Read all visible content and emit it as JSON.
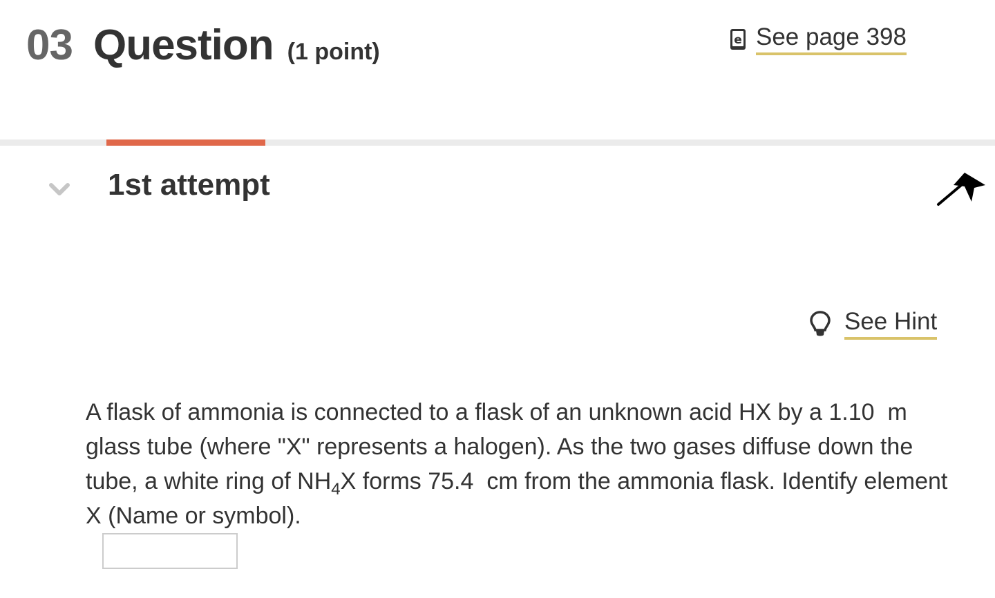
{
  "question": {
    "number": "03",
    "title": "Question",
    "points": "(1 point)",
    "reference_link": "See page 398",
    "reference_icon": "ebook-icon"
  },
  "progress": {
    "fill_fraction": 0.16,
    "color": "#e0684a"
  },
  "attempt": {
    "title": "1st attempt",
    "expand_icon": "chevron-down-icon",
    "flag_icon": "flag-icon"
  },
  "hint": {
    "label": "See Hint",
    "icon": "lightbulb-icon"
  },
  "body": {
    "part1": "A flask of ammonia is connected to a flask of an unknown acid HX by a ",
    "length_value": "1.10",
    "length_unit": "m",
    "part2": " glass tube (where \"X\" represents a halogen). As the two gases diffuse down the tube, a white ring of NH",
    "subscript": "4",
    "part3": "X forms ",
    "distance_value": "75.4",
    "distance_unit": "cm",
    "part4": " from the ammonia flask. Identify element X (Name or symbol)."
  },
  "answer": {
    "value": "",
    "placeholder": ""
  },
  "colors": {
    "accent_underline": "#d9c36a",
    "track": "#ebebeb",
    "text": "#333333"
  }
}
